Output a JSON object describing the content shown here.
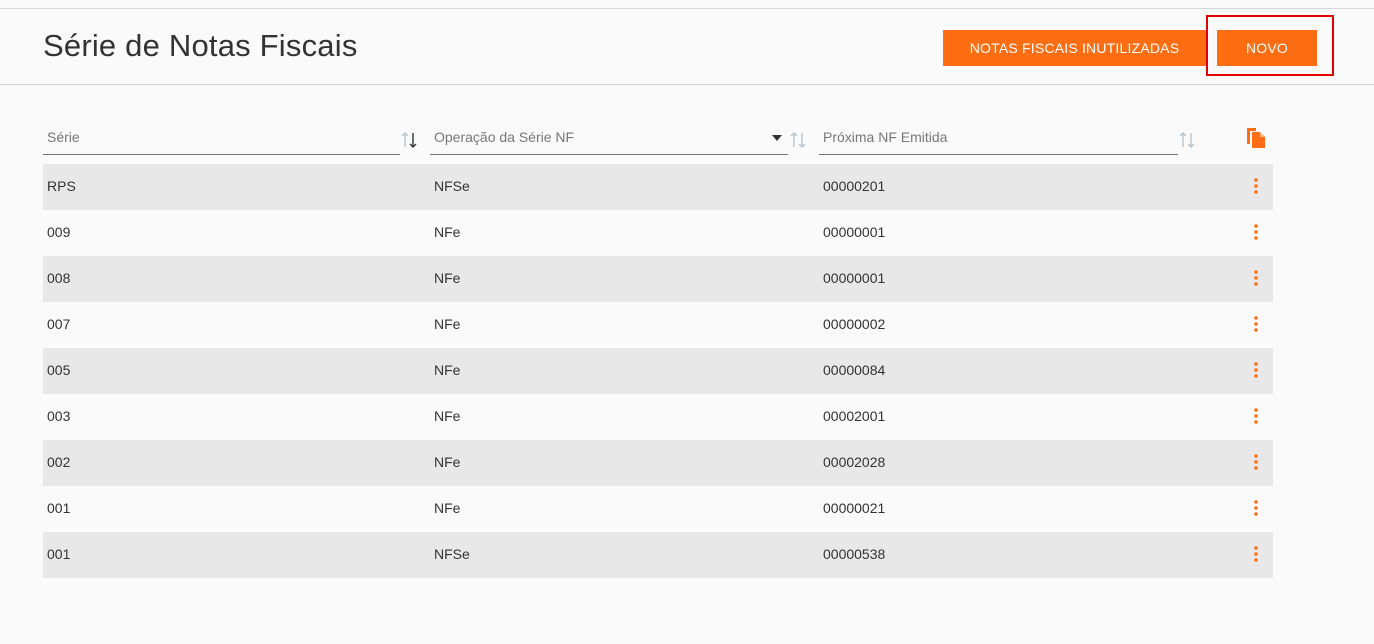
{
  "header": {
    "title": "Série de Notas Fiscais",
    "buttons": {
      "inutilizadas": "NOTAS FISCAIS INUTILIZADAS",
      "novo": "NOVO"
    }
  },
  "table": {
    "columns": {
      "serie": "Série",
      "operacao": "Operação da Série NF",
      "proxima": "Próxima NF Emitida"
    },
    "rows": [
      {
        "serie": "RPS",
        "operacao": "NFSe",
        "proxima": "00000201"
      },
      {
        "serie": "009",
        "operacao": "NFe",
        "proxima": "00000001"
      },
      {
        "serie": "008",
        "operacao": "NFe",
        "proxima": "00000001"
      },
      {
        "serie": "007",
        "operacao": "NFe",
        "proxima": "00000002"
      },
      {
        "serie": "005",
        "operacao": "NFe",
        "proxima": "00000084"
      },
      {
        "serie": "003",
        "operacao": "NFe",
        "proxima": "00002001"
      },
      {
        "serie": "002",
        "operacao": "NFe",
        "proxima": "00002028"
      },
      {
        "serie": "001",
        "operacao": "NFe",
        "proxima": "00000021"
      },
      {
        "serie": "001",
        "operacao": "NFSe",
        "proxima": "00000538"
      }
    ]
  },
  "icons": {
    "sort": "sort-icon",
    "dropdown": "chevron-down-icon",
    "copy": "copy-icon",
    "row_menu": "more-vertical-icon"
  },
  "colors": {
    "accent": "#ff6d12",
    "highlight": "#e00000",
    "row_shade": "#e8e8e8"
  }
}
